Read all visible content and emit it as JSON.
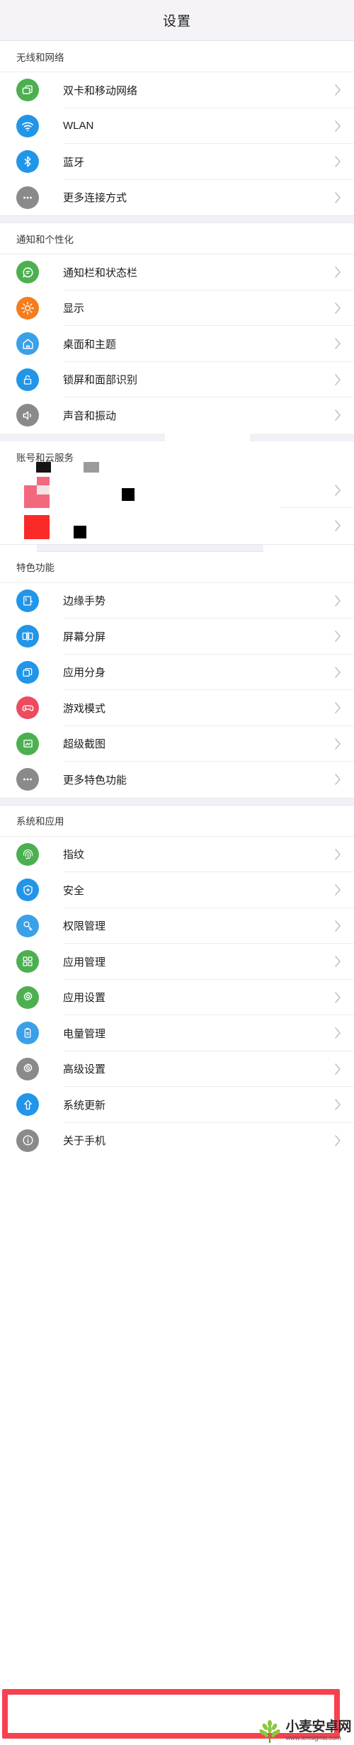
{
  "header": {
    "title": "设置"
  },
  "sections": [
    {
      "id": "wireless-and-network",
      "title": "无线和网络",
      "items": [
        {
          "label": "双卡和移动网络",
          "icon": "sim-card-icon",
          "color": "#4cb050"
        },
        {
          "label": "WLAN",
          "icon": "wifi-icon",
          "color": "#2196e8"
        },
        {
          "label": "蓝牙",
          "icon": "bluetooth-icon",
          "color": "#2196e8"
        },
        {
          "label": "更多连接方式",
          "icon": "more-dots-icon",
          "color": "#8a8a8a"
        }
      ]
    },
    {
      "id": "notification-and-personalization",
      "title": "通知和个性化",
      "items": [
        {
          "label": "通知栏和状态栏",
          "icon": "chat-bubble-icon",
          "color": "#4cb050"
        },
        {
          "label": "显示",
          "icon": "brightness-icon",
          "color": "#f57c1f"
        },
        {
          "label": "桌面和主题",
          "icon": "home-icon",
          "color": "#3aa0e8"
        },
        {
          "label": "锁屏和面部识别",
          "icon": "lock-icon",
          "color": "#2196e8"
        },
        {
          "label": "声音和振动",
          "icon": "speaker-icon",
          "color": "#8a8a8a"
        }
      ]
    },
    {
      "id": "account-and-cloud",
      "title": "账号和云服务",
      "corrupted": true,
      "items": [
        {
          "label": "",
          "icon": "corrupted-icon",
          "color": "#f2697e"
        },
        {
          "label": "",
          "icon": "corrupted-icon",
          "color": "#fb2a27"
        }
      ],
      "glitch_colors": {
        "black": "#141414",
        "dark": "#000000",
        "gray": "#9b9b9b",
        "pink": "#f2697e",
        "pink_light": "#f8e2e6",
        "red": "#fb2a27"
      }
    },
    {
      "id": "featured-functions",
      "title": "特色功能",
      "items": [
        {
          "label": "边缘手势",
          "icon": "edge-gesture-icon",
          "color": "#2196e8"
        },
        {
          "label": "屏幕分屏",
          "icon": "split-screen-icon",
          "color": "#2196e8"
        },
        {
          "label": "应用分身",
          "icon": "app-clone-icon",
          "color": "#2196e8"
        },
        {
          "label": "游戏模式",
          "icon": "gamepad-icon",
          "color": "#ee4a60"
        },
        {
          "label": "超级截图",
          "icon": "screenshot-icon",
          "color": "#4cb050"
        },
        {
          "label": "更多特色功能",
          "icon": "more-dots-icon",
          "color": "#8a8a8a"
        }
      ]
    },
    {
      "id": "system-and-apps",
      "title": "系统和应用",
      "items": [
        {
          "label": "指纹",
          "icon": "fingerprint-icon",
          "color": "#4cb050"
        },
        {
          "label": "安全",
          "icon": "shield-plus-icon",
          "color": "#2196e8"
        },
        {
          "label": "权限管理",
          "icon": "key-icon",
          "color": "#3aa0e8"
        },
        {
          "label": "应用管理",
          "icon": "apps-grid-icon",
          "color": "#4cb050"
        },
        {
          "label": "应用设置",
          "icon": "gear-icon",
          "color": "#4cb050"
        },
        {
          "label": "电量管理",
          "icon": "battery-icon",
          "color": "#3aa0e8"
        },
        {
          "label": "高级设置",
          "icon": "gear-icon",
          "color": "#8a8a8a"
        },
        {
          "label": "系统更新",
          "icon": "upload-arrow-icon",
          "color": "#2196e8"
        },
        {
          "label": "关于手机",
          "icon": "info-icon",
          "color": "#8a8a8a",
          "highlighted": true
        }
      ]
    }
  ],
  "highlight": {
    "target_label": "关于手机",
    "color": "#f8414e"
  },
  "watermark": {
    "title": "小麦安卓网",
    "url": "www.xmsigma.com",
    "logo": "wheat-icon"
  }
}
